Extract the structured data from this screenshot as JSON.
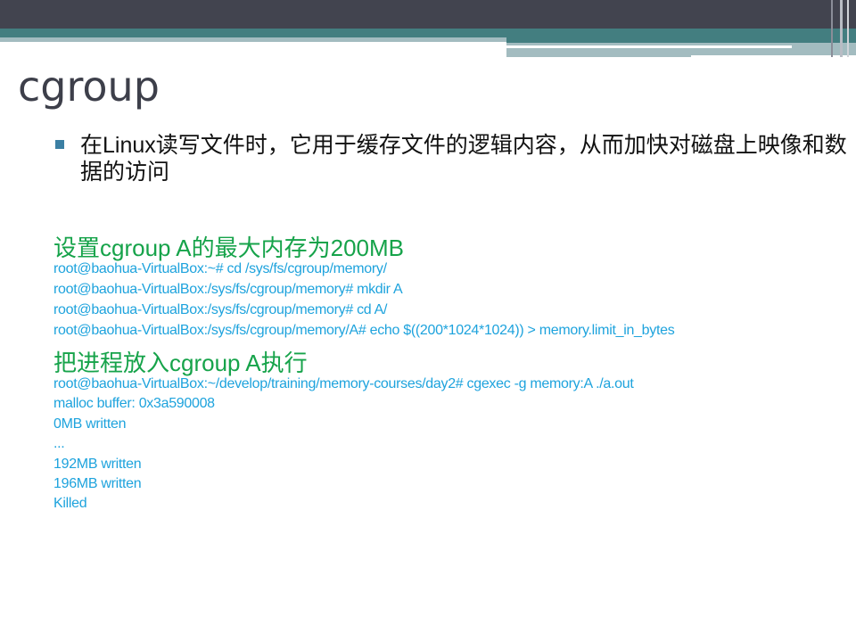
{
  "slide": {
    "title": "cgroup",
    "bullet": "在Linux读写文件时，它用于缓存文件的逻辑内容，从而加快对磁盘上映像和数据的访问",
    "section1_heading": "设置cgroup A的最大内存为200MB",
    "section1_lines": [
      "root@baohua-VirtualBox:~# cd /sys/fs/cgroup/memory/",
      "root@baohua-VirtualBox:/sys/fs/cgroup/memory# mkdir A",
      "root@baohua-VirtualBox:/sys/fs/cgroup/memory# cd A/",
      "root@baohua-VirtualBox:/sys/fs/cgroup/memory/A# echo $((200*1024*1024)) > memory.limit_in_bytes"
    ],
    "section2_heading": "把进程放入cgroup A执行",
    "section2_lines": [
      "root@baohua-VirtualBox:~/develop/training/memory-courses/day2# cgexec -g memory:A ./a.out",
      "malloc buffer: 0x3a590008",
      "0MB written",
      "...",
      "192MB written",
      "196MB written",
      "Killed"
    ]
  },
  "colors": {
    "heading": "#16a34a",
    "code": "#1ea3dd",
    "header_dark": "#42444f",
    "header_teal": "#437e80"
  }
}
